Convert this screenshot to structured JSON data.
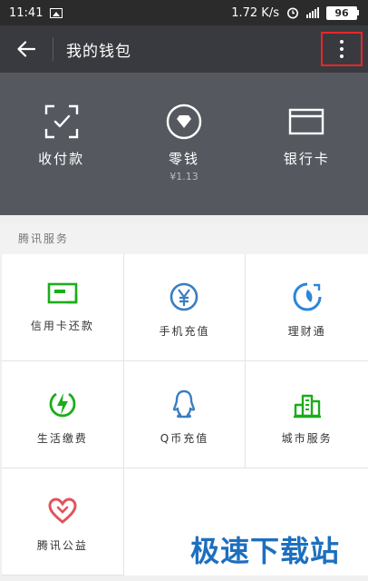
{
  "status_bar": {
    "time": "11:41",
    "speed": "1.72 K/s",
    "battery": "96"
  },
  "nav": {
    "title": "我的钱包"
  },
  "wallet_header": {
    "items": [
      {
        "label": "收付款",
        "icon": "scan-icon"
      },
      {
        "label": "零钱",
        "sub": "¥1.13",
        "icon": "diamond-icon"
      },
      {
        "label": "银行卡",
        "icon": "card-icon"
      }
    ]
  },
  "services": {
    "section_title": "腾讯服务",
    "items": [
      {
        "label": "信用卡还款",
        "icon": "credit-card-icon",
        "color": "#1aad19"
      },
      {
        "label": "手机充值",
        "icon": "yen-icon",
        "color": "#3a7dc1"
      },
      {
        "label": "理财通",
        "icon": "wealth-icon",
        "color": "#2c86d9"
      },
      {
        "label": "生活缴费",
        "icon": "lightning-icon",
        "color": "#1aad19"
      },
      {
        "label": "Q币充值",
        "icon": "qq-penguin-icon",
        "color": "#3a7dc1"
      },
      {
        "label": "城市服务",
        "icon": "city-icon",
        "color": "#1aad19"
      },
      {
        "label": "腾讯公益",
        "icon": "heart-icon",
        "color": "#e3535a"
      }
    ]
  },
  "watermark": "极速下载站"
}
